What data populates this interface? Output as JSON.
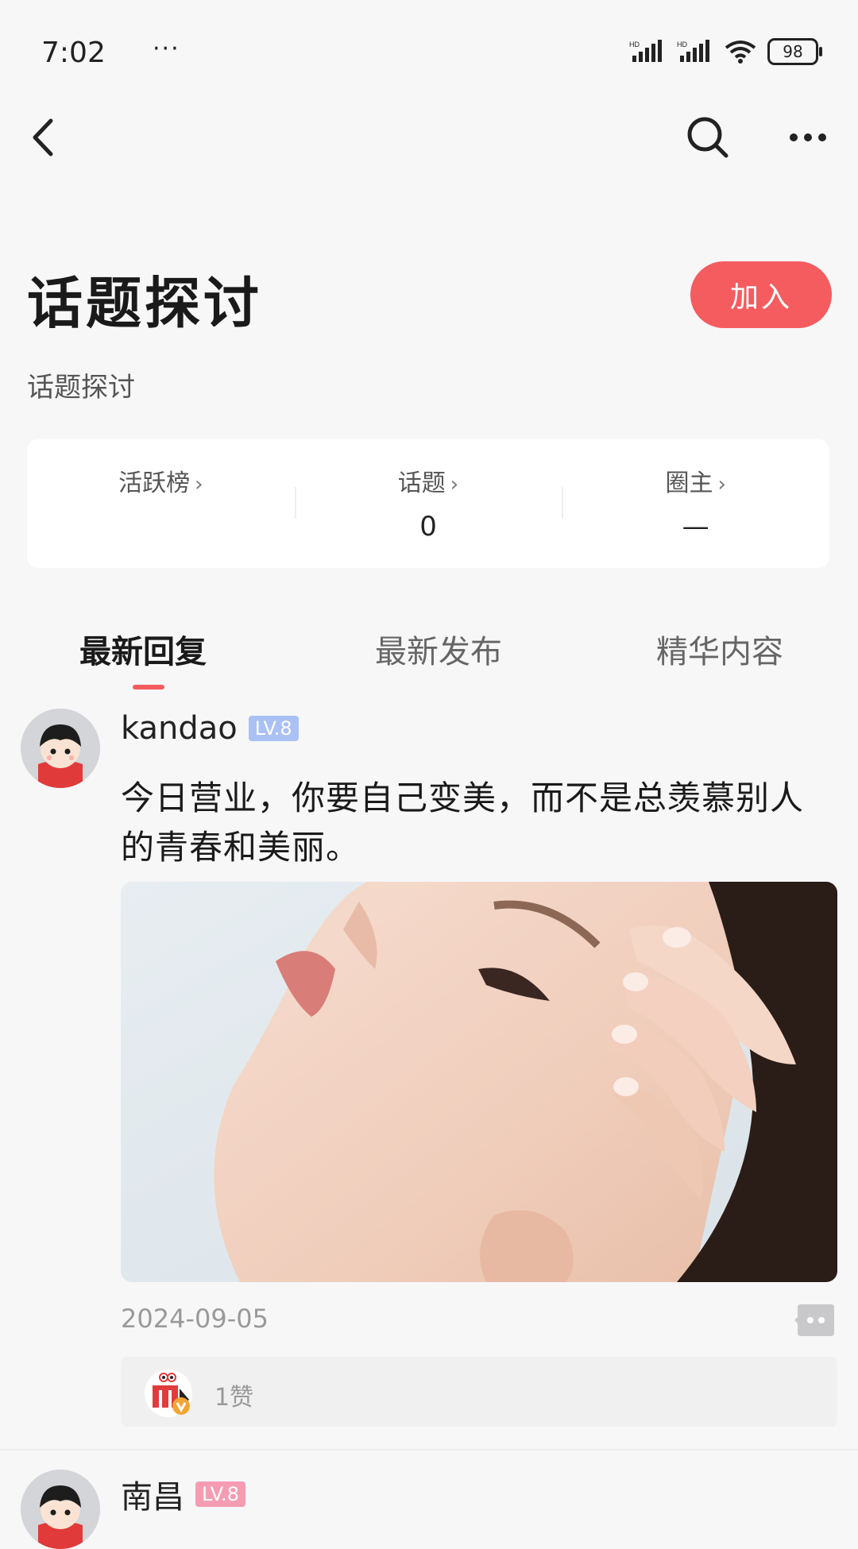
{
  "status_bar": {
    "time": "7:02",
    "dots": "···",
    "battery": "98"
  },
  "nav": {
    "back_icon": "chevron-left-icon",
    "search_icon": "search-icon",
    "more_icon": "more-horizontal-icon"
  },
  "header": {
    "title": "话题探讨",
    "join_label": "加入",
    "subtitle": "话题探讨"
  },
  "stats": [
    {
      "label": "活跃榜",
      "value": ""
    },
    {
      "label": "话题",
      "value": "0"
    },
    {
      "label": "圈主",
      "value": "—"
    }
  ],
  "stats_chevron": "›",
  "tabs": [
    {
      "label": "最新回复",
      "active": true
    },
    {
      "label": "最新发布",
      "active": false
    },
    {
      "label": "精华内容",
      "active": false
    }
  ],
  "posts": [
    {
      "username": "kandao",
      "level": "LV.8",
      "level_color": "#a9c1f5",
      "text": "今日营业，你要自己变美，而不是总羡慕别人的青春和美丽。",
      "date": "2024-09-05",
      "likes": "1赞"
    },
    {
      "username": "南昌",
      "level": "LV.8",
      "level_color": "#f59cb3"
    }
  ],
  "colors": {
    "accent": "#f45c5f",
    "background": "#f7f7f8"
  }
}
